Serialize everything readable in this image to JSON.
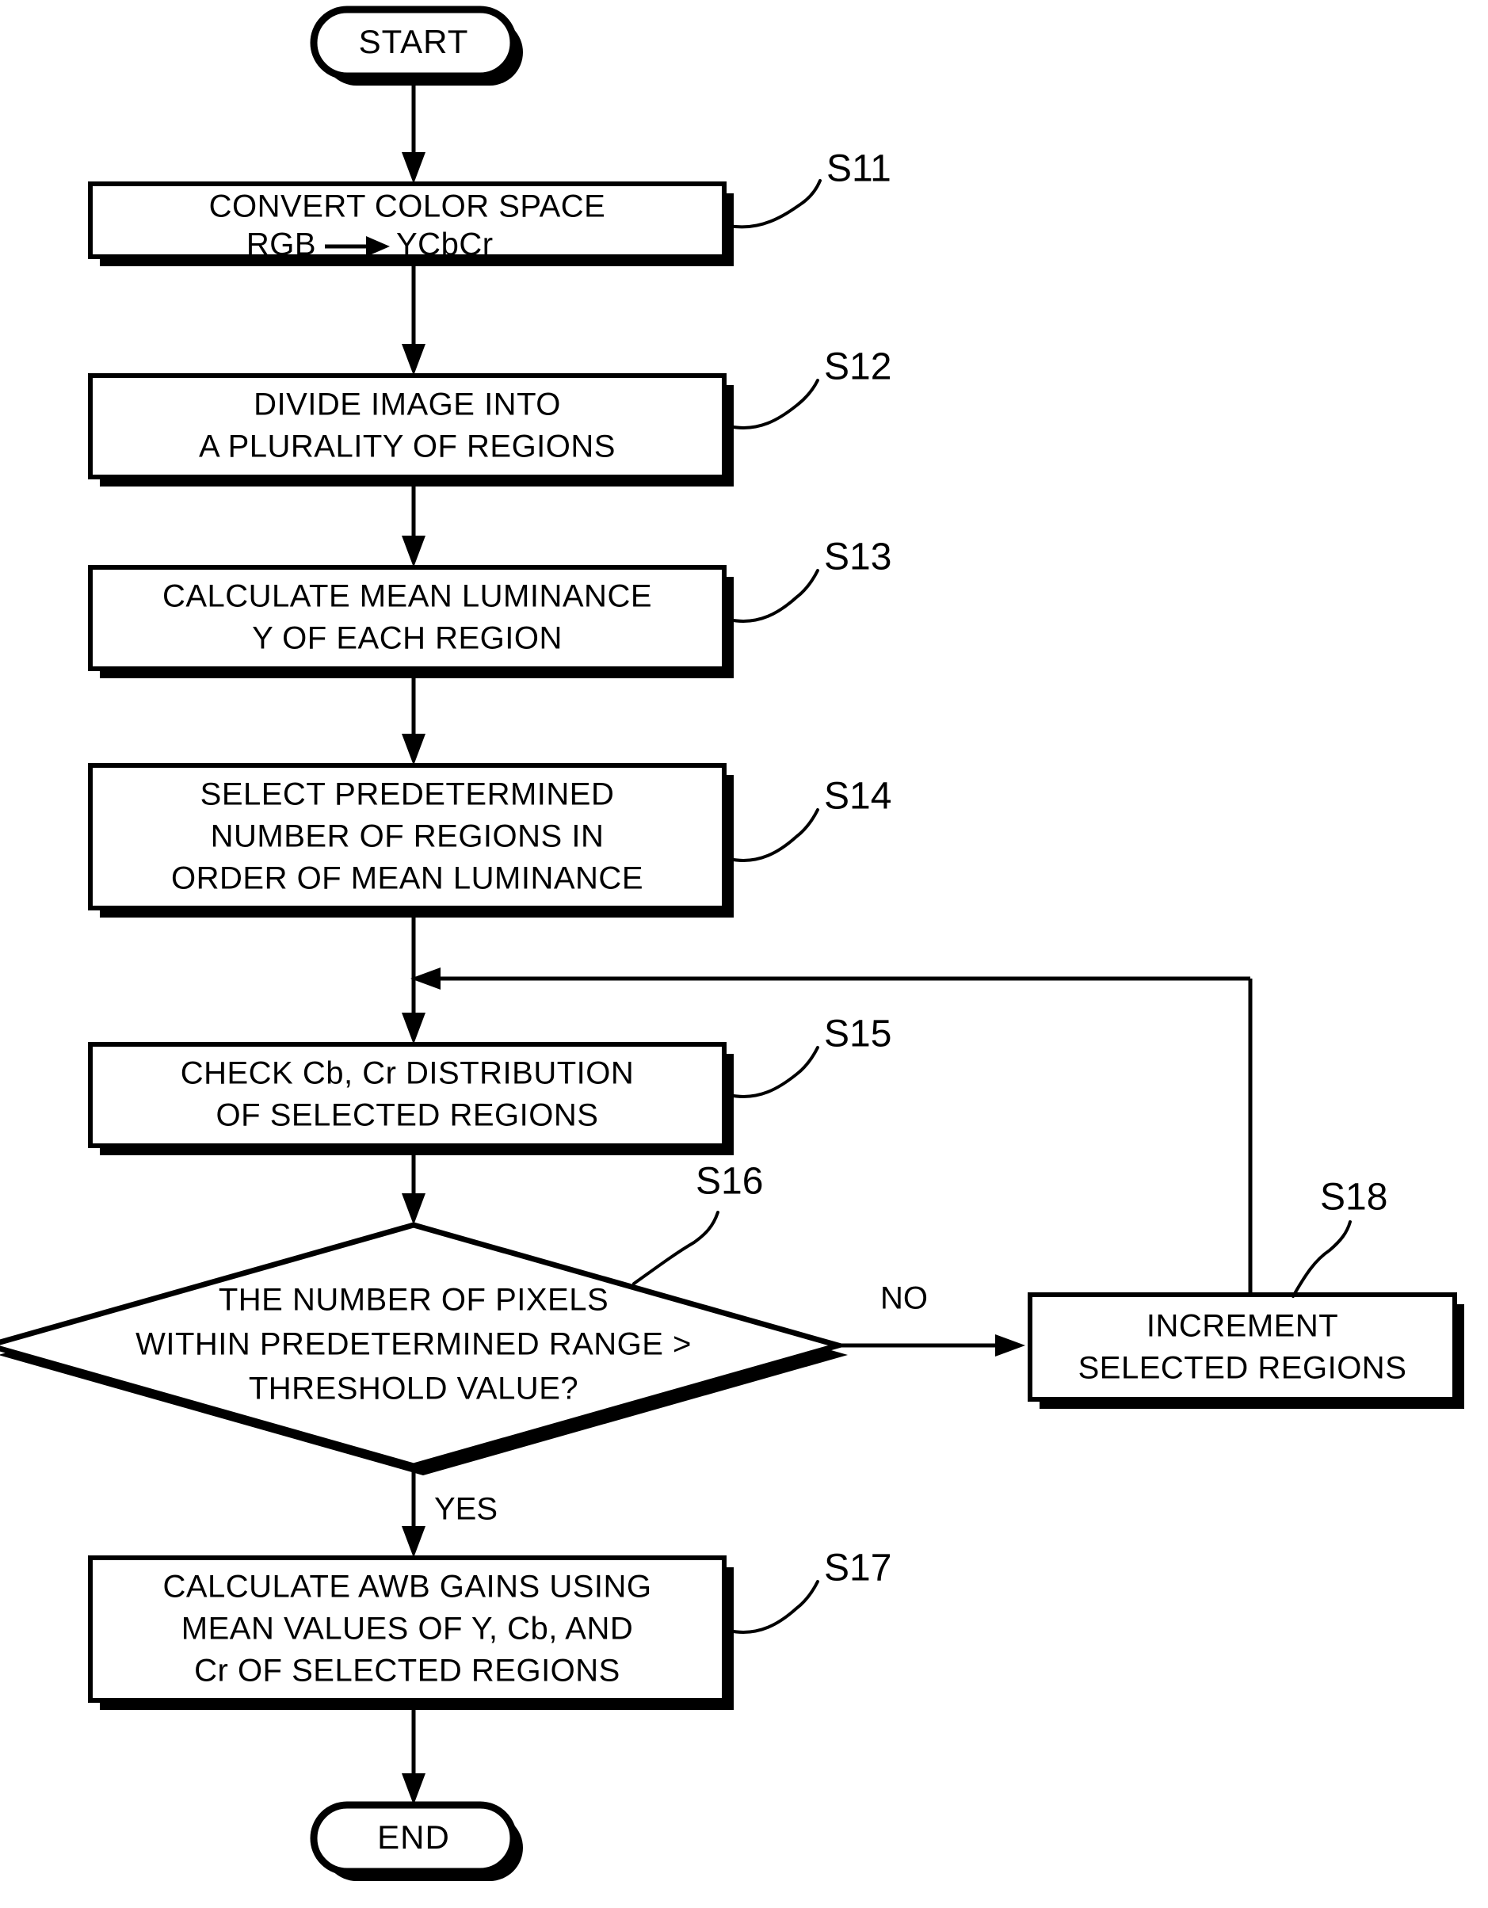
{
  "diagram": {
    "title": "AWB processing flowchart",
    "colors": {
      "ink": "#000000",
      "paper": "#ffffff"
    },
    "nodes": {
      "start": {
        "type": "terminator",
        "label": "START"
      },
      "s11": {
        "type": "process",
        "step": "S11",
        "lines": [
          "CONVERT COLOR SPACE",
          "RGB —▶ YCbCr"
        ],
        "line1": "CONVERT COLOR SPACE",
        "line2_left": "RGB",
        "line2_right": "YCbCr"
      },
      "s12": {
        "type": "process",
        "step": "S12",
        "line1": "DIVIDE IMAGE INTO",
        "line2": "A PLURALITY OF REGIONS"
      },
      "s13": {
        "type": "process",
        "step": "S13",
        "line1": "CALCULATE MEAN LUMINANCE",
        "line2": "Y OF EACH REGION"
      },
      "s14": {
        "type": "process",
        "step": "S14",
        "line1": "SELECT PREDETERMINED",
        "line2": "NUMBER OF REGIONS IN",
        "line3": "ORDER OF MEAN LUMINANCE"
      },
      "s15": {
        "type": "process",
        "step": "S15",
        "line1": "CHECK Cb, Cr DISTRIBUTION",
        "line2": "OF SELECTED REGIONS"
      },
      "s16": {
        "type": "decision",
        "step": "S16",
        "line1": "THE NUMBER OF PIXELS",
        "line2": "WITHIN PREDETERMINED RANGE >",
        "line3": "THRESHOLD VALUE?"
      },
      "s17": {
        "type": "process",
        "step": "S17",
        "line1": "CALCULATE AWB GAINS USING",
        "line2": "MEAN VALUES OF Y, Cb, AND",
        "line3": "Cr OF SELECTED REGIONS"
      },
      "s18": {
        "type": "process",
        "step": "S18",
        "line1": "INCREMENT",
        "line2": "SELECTED REGIONS"
      },
      "end": {
        "type": "terminator",
        "label": "END"
      }
    },
    "edges": {
      "no_label": "NO",
      "yes_label": "YES"
    }
  }
}
